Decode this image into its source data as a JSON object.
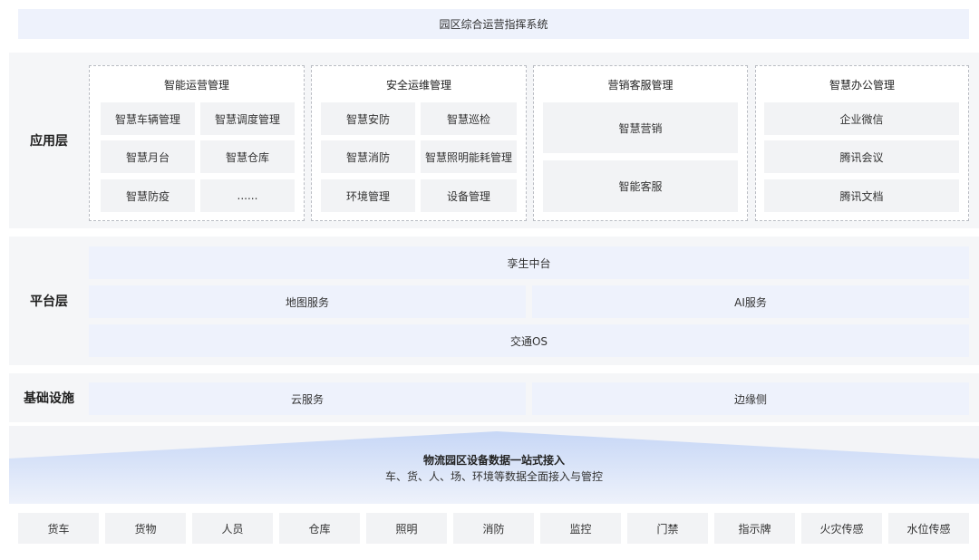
{
  "system_title": "园区综合运营指挥系统",
  "app_layer": {
    "label": "应用层",
    "groups": [
      {
        "title": "智能运营管理",
        "items": [
          "智慧车辆管理",
          "智慧调度管理",
          "智慧月台",
          "智慧仓库",
          "智慧防疫",
          "......"
        ]
      },
      {
        "title": "安全运维管理",
        "items": [
          "智慧安防",
          "智慧巡检",
          "智慧消防",
          "智慧照明能耗管理",
          "环境管理",
          "设备管理"
        ]
      },
      {
        "title": "营销客服管理",
        "items": [
          "智慧营销",
          "智能客服"
        ]
      },
      {
        "title": "智慧办公管理",
        "items": [
          "企业微信",
          "腾讯会议",
          "腾讯文档"
        ]
      }
    ]
  },
  "platform_layer": {
    "label": "平台层",
    "twin": "孪生中台",
    "map": "地图服务",
    "ai": "AI服务",
    "traffic": "交通OS"
  },
  "infra_layer": {
    "label": "基础设施",
    "cloud": "云服务",
    "edge": "边缘侧"
  },
  "access": {
    "title": "物流园区设备数据一站式接入",
    "subtitle": "车、货、人、场、环境等数据全面接入与管控"
  },
  "devices": [
    "货车",
    "货物",
    "人员",
    "仓库",
    "照明",
    "消防",
    "监控",
    "门禁",
    "指示牌",
    "火灾传感",
    "水位传感"
  ],
  "colors": {
    "light_blue": "#eef2fc",
    "gray": "#f2f3f5",
    "border": "#b9bcc3"
  }
}
